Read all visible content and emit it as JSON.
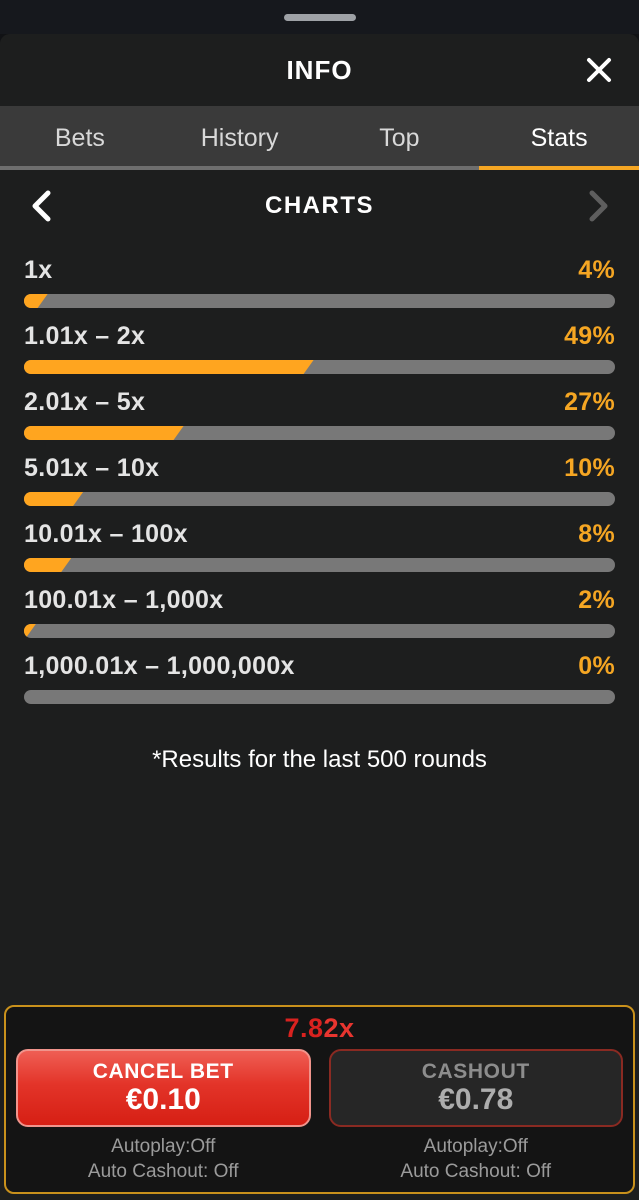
{
  "window": {
    "handle_icon": "drag-handle",
    "title": "INFO",
    "close_icon": "close-icon"
  },
  "tabs": [
    {
      "label": "Bets",
      "active": false
    },
    {
      "label": "History",
      "active": false
    },
    {
      "label": "Top",
      "active": false
    },
    {
      "label": "Stats",
      "active": true
    }
  ],
  "charts_nav": {
    "prev_icon": "chevron-left-icon",
    "next_icon": "chevron-right-icon",
    "heading": "CHARTS"
  },
  "chart_data": {
    "type": "bar",
    "title": "CHARTS",
    "orientation": "horizontal",
    "xlabel": "",
    "ylabel": "",
    "xlim": [
      0,
      100
    ],
    "grid": false,
    "legend": false,
    "unit": "%",
    "categories": [
      "1x",
      "1.01x – 2x",
      "2.01x – 5x",
      "5.01x – 10x",
      "10.01x – 100x",
      "100.01x – 1,000x",
      "1,000.01x – 1,000,000x"
    ],
    "values": [
      4,
      49,
      27,
      10,
      8,
      2,
      0
    ],
    "value_labels": [
      "4%",
      "49%",
      "27%",
      "10%",
      "8%",
      "2%",
      "0%"
    ],
    "annotations": [
      "*Results for the last 500 rounds"
    ],
    "sample_size": 500,
    "bar_color": "#ffa51f",
    "track_color": "#787878"
  },
  "footnote": "*Results for the last 500 rounds",
  "bet_panel": {
    "multiplier": "7.82x",
    "multiplier_part_a": "7.8",
    "multiplier_part_b": "2x",
    "multiplier_color": "#e52421",
    "panel_border_color": "#c9911c",
    "left": {
      "button_title": "CANCEL BET",
      "button_amount": "€0.10",
      "autoplay": "Autoplay:Off",
      "auto_cashout": "Auto Cashout: Off"
    },
    "right": {
      "button_title": "CASHOUT",
      "button_amount": "€0.78",
      "autoplay": "Autoplay:Off",
      "auto_cashout": "Auto Cashout: Off"
    }
  },
  "colors": {
    "accent": "#f5a623",
    "bar": "#ffa51f",
    "danger": "#e52421",
    "panel": "#1d1e1e",
    "tabbar": "#3a3a3a"
  }
}
